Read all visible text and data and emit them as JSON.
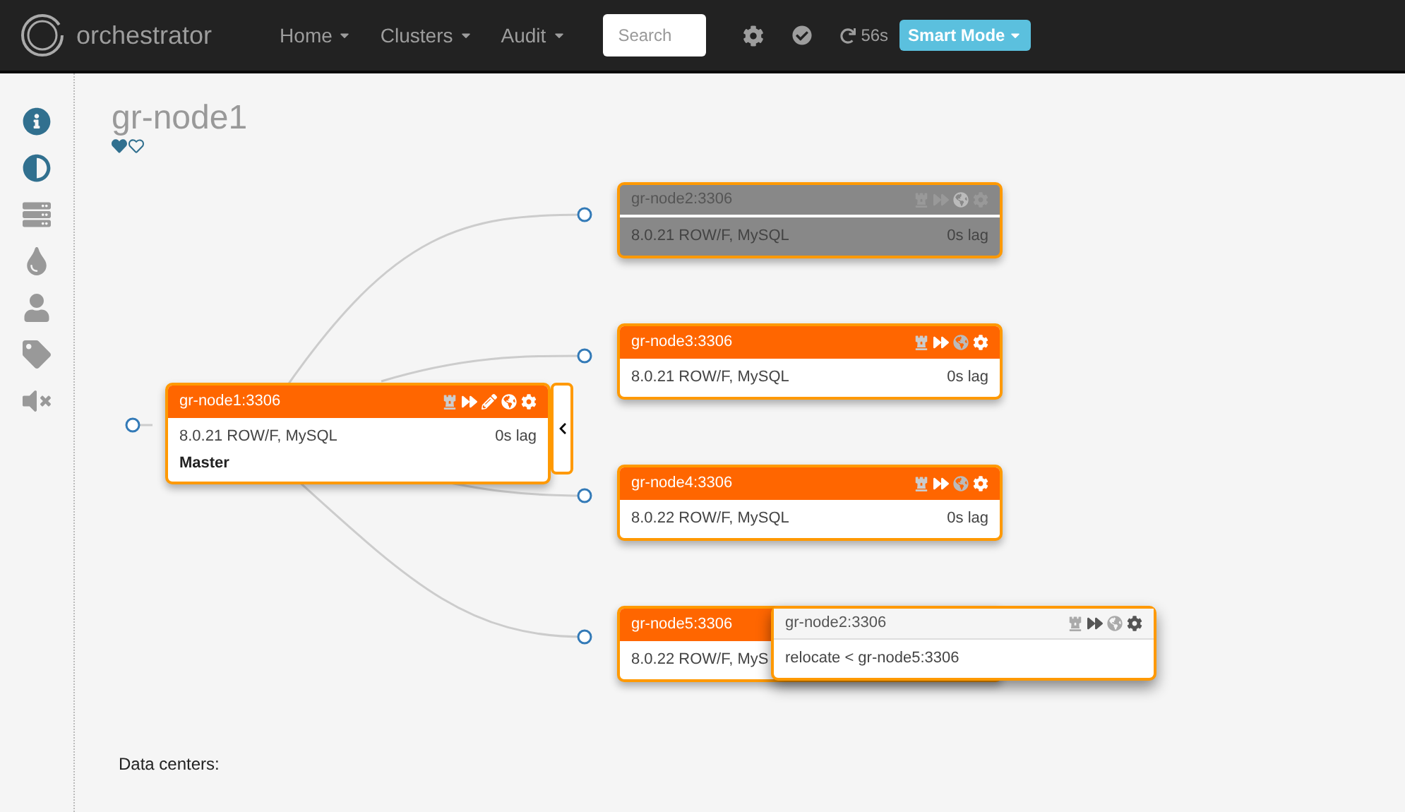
{
  "navbar": {
    "brand": "orchestrator",
    "menus": [
      "Home",
      "Clusters",
      "Audit"
    ],
    "search": {
      "placeholder": "Search"
    },
    "refresh": "56s",
    "mode_button": "Smart Mode"
  },
  "cluster": {
    "title": "gr-node1"
  },
  "nodes": [
    {
      "kind": "master",
      "name": "gr-node1:3306",
      "version": "8.0.21 ROW/F, MySQL",
      "lag": "0s lag",
      "role": "Master",
      "dimmed": false
    },
    {
      "kind": "replica",
      "name": "gr-node2:3306",
      "version": "8.0.21 ROW/F, MySQL",
      "lag": "0s lag",
      "dimmed": true
    },
    {
      "kind": "replica",
      "name": "gr-node3:3306",
      "version": "8.0.21 ROW/F, MySQL",
      "lag": "0s lag",
      "dimmed": false
    },
    {
      "kind": "replica",
      "name": "gr-node4:3306",
      "version": "8.0.22 ROW/F, MySQL",
      "lag": "0s lag",
      "dimmed": false
    },
    {
      "kind": "replica",
      "name": "gr-node5:3306",
      "version": "8.0.22 ROW/F, MyS",
      "dimmed": false
    }
  ],
  "drop_popup": {
    "name": "gr-node2:3306",
    "action": "relocate < gr-node5:3306"
  },
  "footer": {
    "label": "Data centers:"
  }
}
